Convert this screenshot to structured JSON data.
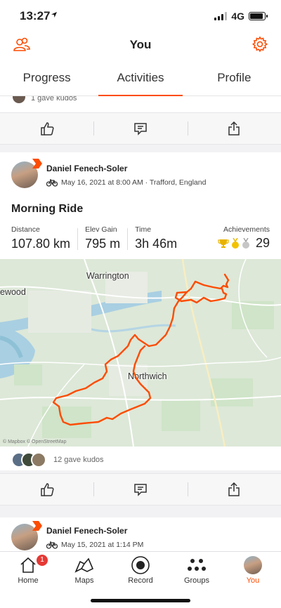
{
  "status_bar": {
    "time": "13:27",
    "network": "4G",
    "battery_level": 0.9,
    "signal_bars": 3
  },
  "header": {
    "title": "You",
    "left_icon": "people-icon",
    "right_icon": "gear-icon"
  },
  "tabs": [
    {
      "label": "Progress",
      "active": false
    },
    {
      "label": "Activities",
      "active": true
    },
    {
      "label": "Profile",
      "active": false
    }
  ],
  "feed": {
    "previous_card": {
      "kudos_text": "1 gave kudos"
    },
    "activities": [
      {
        "athlete": "Daniel Fenech-Soler",
        "meta": "May 16, 2021 at 8:00 AM · Trafford, England",
        "activity_icon": "bike-icon",
        "title": "Morning Ride",
        "stats": [
          {
            "label": "Distance",
            "value": "107.80 km"
          },
          {
            "label": "Elev Gain",
            "value": "795 m"
          },
          {
            "label": "Time",
            "value": "3h 46m"
          }
        ],
        "achievements": {
          "label": "Achievements",
          "value": "29"
        },
        "map": {
          "labels": [
            "Warrington",
            "ewood",
            "Northwich"
          ],
          "attribution": "© Mapbox © OpenStreetMap"
        },
        "kudos_text": "12 gave kudos"
      },
      {
        "athlete": "Daniel Fenech-Soler",
        "meta": "May 15, 2021 at 1:14 PM",
        "activity_icon": "bike-icon"
      }
    ],
    "actions": [
      "kudos-icon",
      "comment-icon",
      "share-icon"
    ]
  },
  "tab_bar": {
    "items": [
      {
        "label": "Home",
        "icon": "home-icon",
        "badge": "1",
        "active": false
      },
      {
        "label": "Maps",
        "icon": "map-icon",
        "active": false
      },
      {
        "label": "Record",
        "icon": "record-icon",
        "active": false
      },
      {
        "label": "Groups",
        "icon": "groups-icon",
        "active": false
      },
      {
        "label": "You",
        "icon": "avatar",
        "active": true
      }
    ]
  },
  "colors": {
    "accent": "#fc4c02",
    "route": "#fc4c02",
    "badge": "#e53935"
  }
}
